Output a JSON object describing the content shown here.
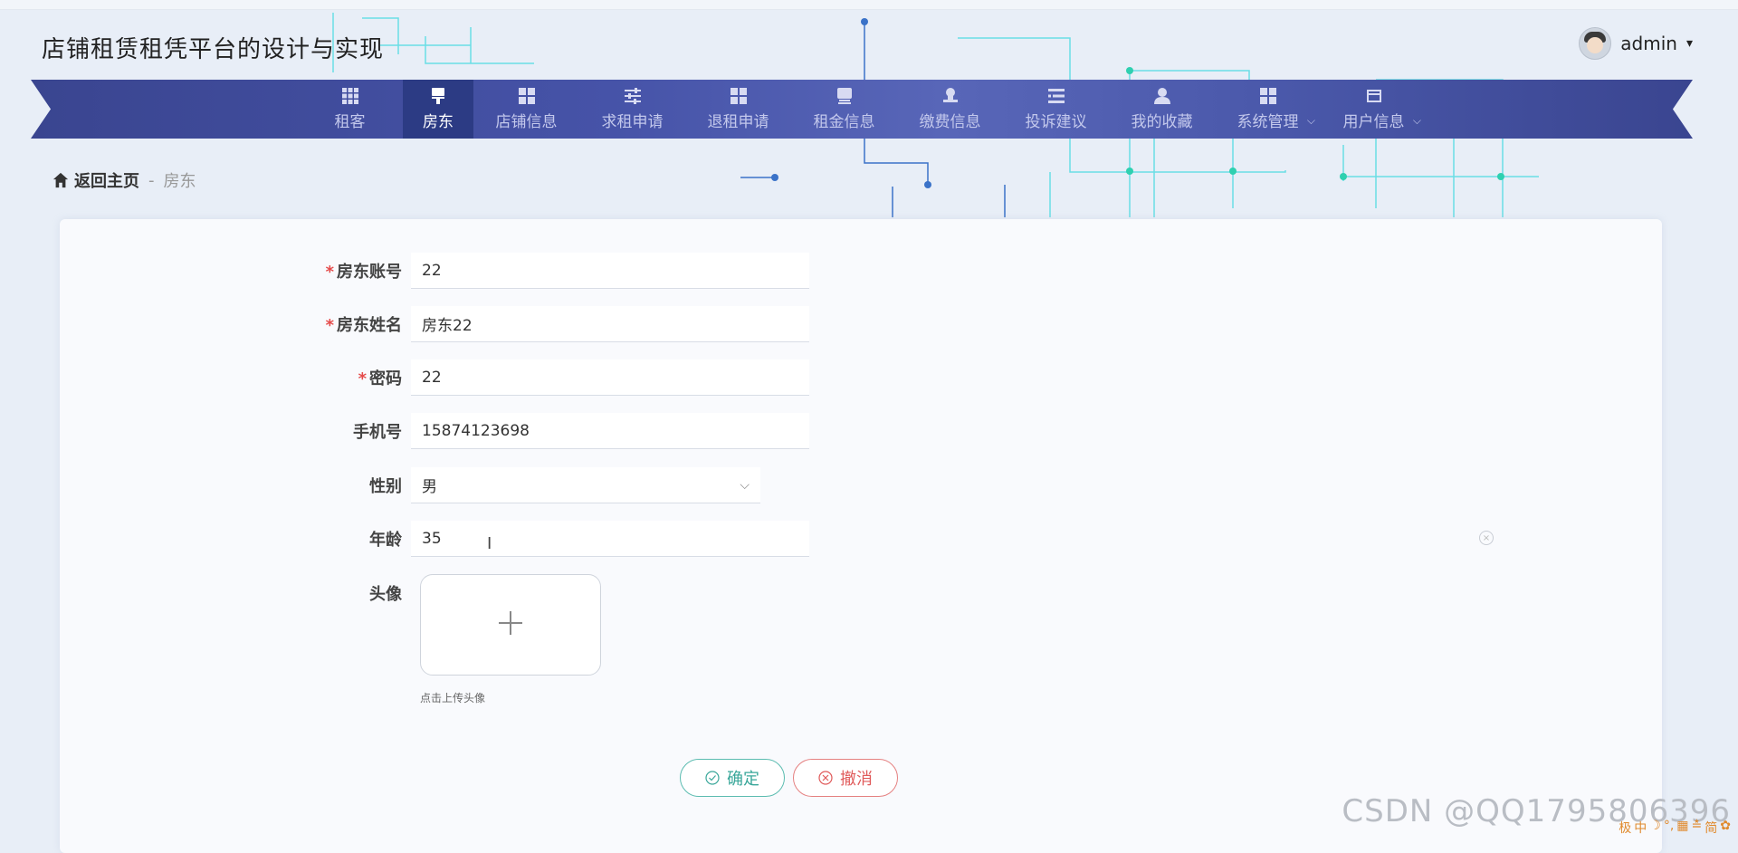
{
  "site_title": "店铺租赁租凭平台的设计与实现",
  "user": {
    "name": "admin",
    "caret": "▾"
  },
  "nav": {
    "items": [
      {
        "label": "租客"
      },
      {
        "label": "房东"
      },
      {
        "label": "店铺信息"
      },
      {
        "label": "求租申请"
      },
      {
        "label": "退租申请"
      },
      {
        "label": "租金信息"
      },
      {
        "label": "缴费信息"
      },
      {
        "label": "投诉建议"
      },
      {
        "label": "我的收藏"
      },
      {
        "label": "系统管理"
      },
      {
        "label": "用户信息"
      }
    ],
    "dropdown_arrow": "⌵"
  },
  "breadcrumb": {
    "home": "返回主页",
    "separator": "-",
    "current": "房东"
  },
  "form": {
    "required_mark": "*",
    "account_label": "房东账号",
    "account_value": "22",
    "name_label": "房东姓名",
    "name_value": "房东22",
    "password_label": "密码",
    "password_value": "22",
    "phone_label": "手机号",
    "phone_value": "15874123698",
    "gender_label": "性别",
    "gender_value": "男",
    "age_label": "年龄",
    "age_value": "35",
    "avatar_label": "头像",
    "upload_hint": "点击上传头像",
    "confirm_label": "确定",
    "cancel_label": "撤消"
  },
  "watermark": "CSDN @QQ1795806396",
  "ime_bar": [
    "极",
    "中",
    "☽",
    "°,",
    "▦",
    "≛",
    "简",
    "✿"
  ]
}
